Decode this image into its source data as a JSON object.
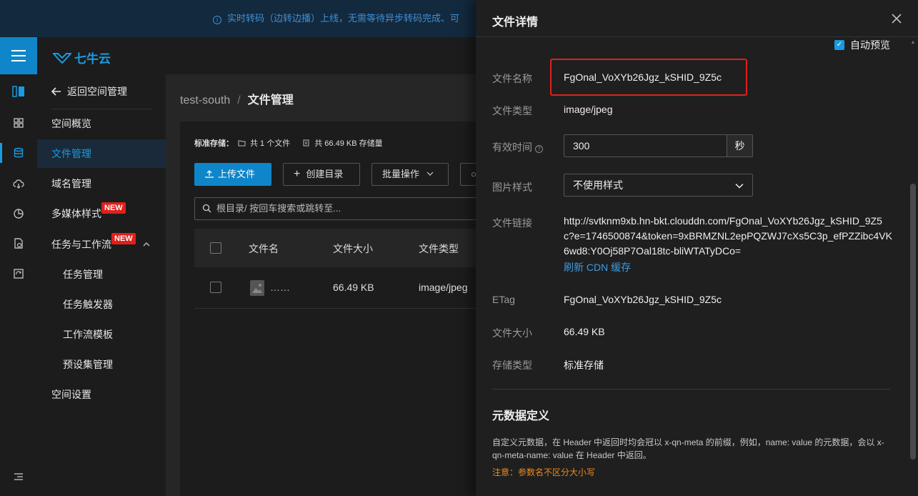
{
  "banner": {
    "text": "实时转码（边转边播）上线，无需等待异步转码完成、可"
  },
  "brand": {
    "logo_text": "七牛云"
  },
  "sidebar": {
    "back_label": "返回空间管理",
    "items": [
      {
        "label": "空间概览"
      },
      {
        "label": "文件管理"
      },
      {
        "label": "域名管理"
      },
      {
        "label": "多媒体样式",
        "badge": "NEW"
      },
      {
        "label": "任务与工作流",
        "badge": "NEW"
      },
      {
        "label": "任务管理"
      },
      {
        "label": "任务触发器"
      },
      {
        "label": "工作流模板"
      },
      {
        "label": "预设集管理"
      },
      {
        "label": "空间设置"
      }
    ]
  },
  "main": {
    "breadcrumb": {
      "bucket": "test-south",
      "separator": "/",
      "current": "文件管理"
    },
    "stats": {
      "storage_label": "标准存储：",
      "file_count": "共 1 个文件",
      "storage_size": "共 66.49 KB 存储量"
    },
    "buttons": {
      "upload": "上传文件",
      "create_dir": "创建目录",
      "batch": "批量操作"
    },
    "search_placeholder": "根目录/ 按回车搜索或跳转至...",
    "table": {
      "headers": [
        "文件名",
        "文件大小",
        "文件类型"
      ],
      "rows": [
        {
          "name": "……",
          "size": "66.49 KB",
          "type": "image/jpeg"
        }
      ]
    }
  },
  "drawer": {
    "title": "文件详情",
    "close": "X",
    "auto_preview": "自动预览",
    "fields": {
      "name_label": "文件名称",
      "name_value": "FgOnal_VoXYb26Jgz_kSHID_9Z5c",
      "type_label": "文件类型",
      "type_value": "image/jpeg",
      "expire_label": "有效时间",
      "expire_value": "300",
      "expire_unit": "秒",
      "style_label": "图片样式",
      "style_value": "不使用样式",
      "link_label": "文件链接",
      "link_value": "http://svtknm9xb.hn-bkt.clouddn.com/FgOnal_VoXYb26Jgz_kSHID_9Z5c?e=1746500874&token=9xBRMZNL2epPQZWJ7cXs5C3p_efPZZibc4VK6wd8:Y0Oj58P7Oal18tc-bliWTATyDCo=",
      "refresh_cdn": "刷新 CDN 缓存",
      "etag_label": "ETag",
      "etag_value": "FgOnal_VoXYb26Jgz_kSHID_9Z5c",
      "size_label": "文件大小",
      "size_value": "66.49 KB",
      "storage_label": "存储类型",
      "storage_value": "标准存储"
    },
    "metadata": {
      "heading": "元数据定义",
      "description": "自定义元数据，在 Header 中返回时均会冠以 x-qn-meta 的前缀，例如，name: value 的元数据，会以 x-qn-meta-name: value 在 Header 中返回。",
      "note": "注意：参数名不区分大小写"
    }
  },
  "colors": {
    "accent": "#1a9ae0",
    "badge": "#e0201c",
    "warning": "#f08a1c"
  }
}
